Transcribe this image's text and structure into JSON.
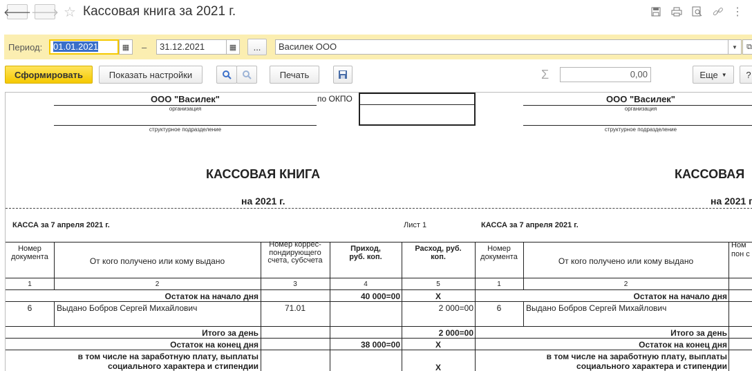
{
  "window": {
    "title": "Кассовая книга за 2021 г.",
    "back_glyph": "🡐",
    "forward_glyph": "🡒",
    "star_glyph": "☆"
  },
  "toolbar": {
    "period_label": "Период:",
    "date_from": "01.01.2021",
    "dash": "–",
    "date_to": "31.12.2021",
    "ellipsis": "...",
    "organization": "Василек ООО",
    "generate_label": "Сформировать",
    "settings_label": "Показать настройки",
    "print_label": "Печать",
    "sum_value": "0,00",
    "more_label": "Еще",
    "help_label": "?",
    "accent": "#f5c900"
  },
  "report": {
    "org_name": "ООО \"Василек\"",
    "org_caption": "организация",
    "okpo_label": "по ОКПО",
    "division_caption": "структурное подразделение",
    "book_title": "КАССОВАЯ КНИГА",
    "book_title_right": "КАССОВАЯ",
    "year": "на 2021 г.",
    "kassa_line": "КАССА за 7 апреля 2021 г.",
    "sheet_label": "Лист 1",
    "headers": {
      "doc_no": "Номер документа",
      "doc_no_right": "Номер документа",
      "from_to": "От кого получено или кому выдано",
      "account": "Номер коррес-пондирующего счета, субсчета",
      "account_right_partial": "Ном пон с",
      "income": "Приход, руб. коп.",
      "expense": "Расход, руб. коп."
    },
    "col_numbers": [
      "1",
      "2",
      "3",
      "4",
      "5"
    ],
    "rows": {
      "opening_label": "Остаток на начало дня",
      "opening_income": "40 000=00",
      "opening_expense": "X",
      "doc_num": "6",
      "doc_text": "Выдано Бобров Сергей Михайлович",
      "doc_account": "71.01",
      "doc_expense": "2 000=00",
      "total_label": "Итого за день",
      "total_expense": "2 000=00",
      "closing_label": "Остаток на конец  дня",
      "closing_income": "38 000=00",
      "closing_expense": "X",
      "salary_label": "в том числе на заработную плату, выплаты социального характера и стипендии",
      "salary_expense": "X"
    }
  }
}
